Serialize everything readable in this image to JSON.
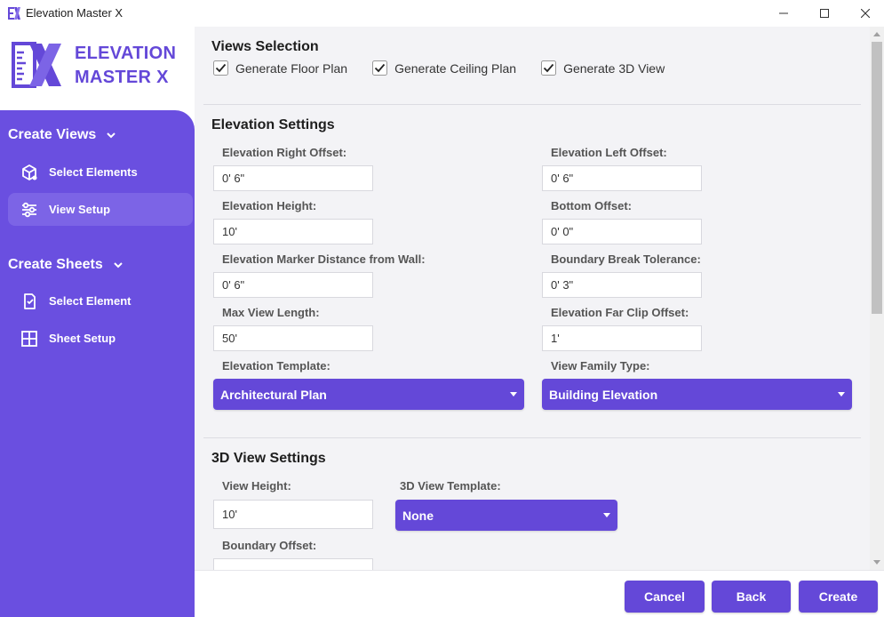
{
  "window": {
    "title": "Elevation Master X",
    "icon": "app-logo-icon",
    "controls": [
      "minimize-icon",
      "maximize-icon",
      "close-icon"
    ]
  },
  "brand": {
    "line1": "ELEVATION",
    "line2": "MASTER X",
    "color": "#6448d8"
  },
  "sidebar": {
    "background": "#6a4fe0",
    "sections": [
      {
        "title": "Create Views",
        "items": [
          {
            "label": "Select Elements",
            "icon": "cube-select-icon",
            "active": false
          },
          {
            "label": "View Setup",
            "icon": "sliders-icon",
            "active": true
          }
        ]
      },
      {
        "title": "Create Sheets",
        "items": [
          {
            "label": "Select Element",
            "icon": "sheet-select-icon",
            "active": false
          },
          {
            "label": "Sheet Setup",
            "icon": "grid-layout-icon",
            "active": false
          }
        ]
      }
    ]
  },
  "views_selection": {
    "title": "Views Selection",
    "options": [
      {
        "label": "Generate Floor Plan",
        "checked": true
      },
      {
        "label": "Generate Ceiling Plan",
        "checked": true
      },
      {
        "label": "Generate 3D View",
        "checked": true
      }
    ]
  },
  "elevation_settings": {
    "title": "Elevation Settings",
    "fields": [
      {
        "label": "Elevation Right Offset:",
        "value": "0' 6\""
      },
      {
        "label": "Elevation Left Offset:",
        "value": "0' 6\""
      },
      {
        "label": "Elevation Height:",
        "value": "10'"
      },
      {
        "label": "Bottom Offset:",
        "value": "0' 0\""
      },
      {
        "label": "Elevation Marker Distance from Wall:",
        "value": "0' 6\""
      },
      {
        "label": "Boundary Break Tolerance:",
        "value": "0' 3\""
      },
      {
        "label": "Max View Length:",
        "value": "50'"
      },
      {
        "label": "Elevation Far Clip Offset:",
        "value": "1'"
      }
    ],
    "template_label": "Elevation Template:",
    "template_value": "Architectural Plan",
    "family_label": "View Family Type:",
    "family_value": "Building Elevation"
  },
  "view3d_settings": {
    "title": "3D View Settings",
    "height_label": "View Height:",
    "height_value": "10'",
    "template_label": "3D View Template:",
    "template_value": "None",
    "boundary_label": "Boundary Offset:",
    "boundary_value": ""
  },
  "footer": {
    "cancel": "Cancel",
    "back": "Back",
    "create": "Create"
  }
}
